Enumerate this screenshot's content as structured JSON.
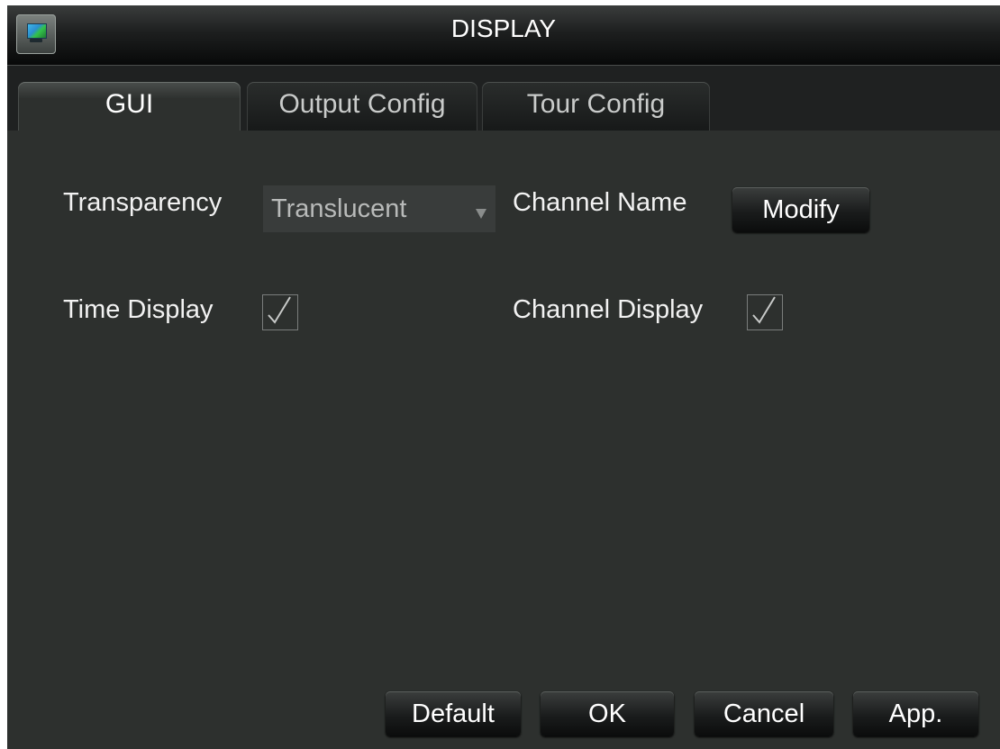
{
  "window": {
    "title": "DISPLAY",
    "icon": "monitor-icon"
  },
  "tabs": [
    {
      "label": "GUI",
      "active": true
    },
    {
      "label": "Output Config",
      "active": false
    },
    {
      "label": "Tour Config",
      "active": false
    }
  ],
  "gui": {
    "transparency": {
      "label": "Transparency",
      "value": "Translucent"
    },
    "channel_name": {
      "label": "Channel Name",
      "button_label": "Modify"
    },
    "time_display": {
      "label": "Time Display",
      "checked": true
    },
    "channel_display": {
      "label": "Channel Display",
      "checked": true
    }
  },
  "footer": {
    "default_label": "Default",
    "ok_label": "OK",
    "cancel_label": "Cancel",
    "apply_label": "App."
  },
  "colors": {
    "background": "#2d302e",
    "text": "#f2f2f2",
    "dropdown_bg": "#393c3b",
    "checkbox_border": "#7a7d7c"
  }
}
